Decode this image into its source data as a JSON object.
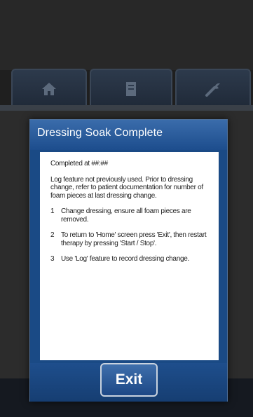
{
  "tabs": [
    {
      "icon": "home-icon"
    },
    {
      "icon": "document-icon"
    },
    {
      "icon": "tools-icon"
    }
  ],
  "dialog": {
    "title": "Dressing Soak Complete",
    "completed": "Completed at ##:##",
    "notice": "Log feature not previously used. Prior to dressing change, refer to patient documentation for number of foam pieces at last dressing change.",
    "steps": [
      {
        "num": "1",
        "text": "Change dressing, ensure all foam pieces are removed."
      },
      {
        "num": "2",
        "text": "To return to 'Home' screen press 'Exit', then restart therapy by pressing 'Start / Stop'."
      },
      {
        "num": "3",
        "text": "Use 'Log' feature to record dressing change."
      }
    ],
    "exit_label": "Exit"
  },
  "colors": {
    "dialog_blue": "#1a4a85",
    "header_blue": "#3a6cab",
    "tab_dim": "#2d3a4c"
  }
}
